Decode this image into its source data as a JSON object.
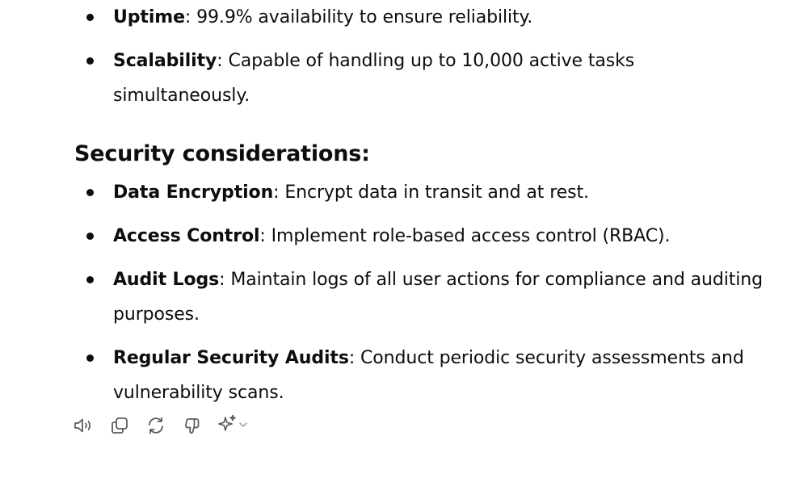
{
  "top_list": [
    {
      "term": "Uptime",
      "text": ": 99.9% availability to ensure reliability."
    },
    {
      "term": "Scalability",
      "text": ": Capable of handling up to 10,000 active tasks simultaneously."
    }
  ],
  "security": {
    "heading": "Security considerations:",
    "items": [
      {
        "term": "Data Encryption",
        "text": ": Encrypt data in transit and at rest."
      },
      {
        "term": "Access Control",
        "text": ": Implement role-based access control (RBAC)."
      },
      {
        "term": "Audit Logs",
        "text": ": Maintain logs of all user actions for compliance and auditing purposes."
      },
      {
        "term": "Regular Security Audits",
        "text": ": Conduct periodic security assessments and vulnerability scans."
      }
    ]
  },
  "actions": {
    "icons": [
      "read-aloud-icon",
      "copy-icon",
      "regenerate-icon",
      "thumbs-down-icon",
      "sparkle-icon",
      "chevron-down-icon"
    ],
    "icon_color": "#5d5d5d"
  }
}
